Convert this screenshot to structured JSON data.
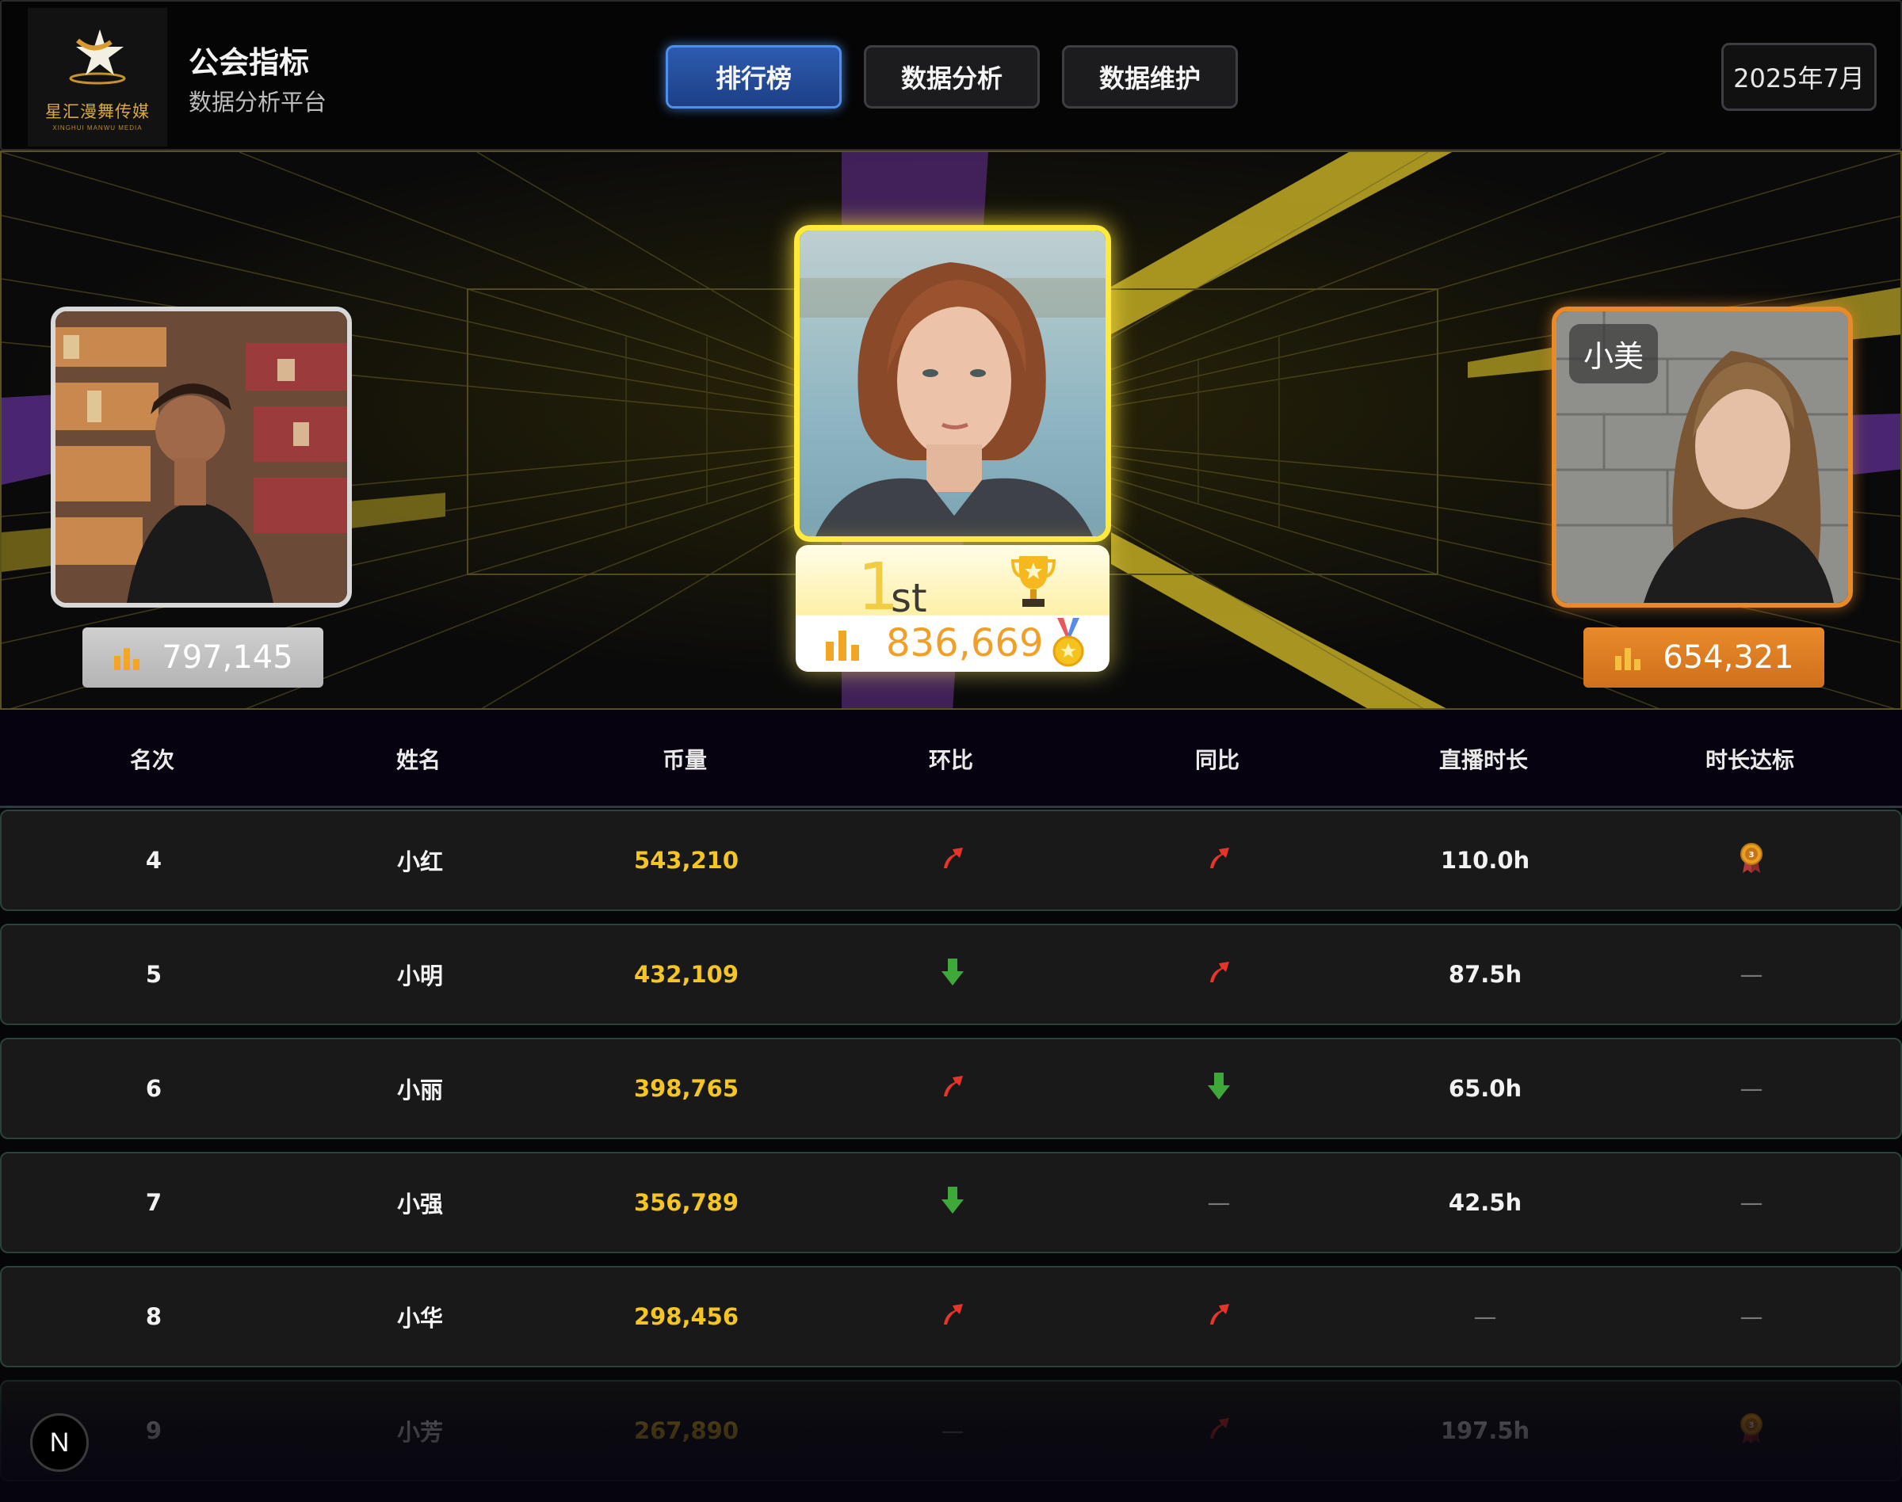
{
  "header": {
    "logo_text": "星汇漫舞传媒",
    "logo_subtext": "XINGHUI MANWU MEDIA",
    "title": "公会指标",
    "subtitle": "数据分析平台",
    "nav": [
      {
        "label": "排行榜",
        "active": true
      },
      {
        "label": "数据分析",
        "active": false
      },
      {
        "label": "数据维护",
        "active": false
      }
    ],
    "month": "2025年7月"
  },
  "podium": {
    "first": {
      "rank_number": "1",
      "rank_suffix": "st",
      "score": "836,669",
      "frame_color": "#ffe93a"
    },
    "second": {
      "score": "797,145",
      "frame_color": "#d8d8d8"
    },
    "third": {
      "name": "小美",
      "score": "654,321",
      "frame_color": "#e88a2a"
    }
  },
  "table": {
    "headers": [
      "名次",
      "姓名",
      "币量",
      "环比",
      "同比",
      "直播时长",
      "时长达标"
    ],
    "rows": [
      {
        "rank": "4",
        "name": "小红",
        "coins": "543,210",
        "mom": "up",
        "yoy": "up",
        "hours": "110.0h",
        "target": "medal"
      },
      {
        "rank": "5",
        "name": "小明",
        "coins": "432,109",
        "mom": "down",
        "yoy": "up",
        "hours": "87.5h",
        "target": "—"
      },
      {
        "rank": "6",
        "name": "小丽",
        "coins": "398,765",
        "mom": "up",
        "yoy": "down",
        "hours": "65.0h",
        "target": "—"
      },
      {
        "rank": "7",
        "name": "小强",
        "coins": "356,789",
        "mom": "down",
        "yoy": "—",
        "hours": "42.5h",
        "target": "—"
      },
      {
        "rank": "8",
        "name": "小华",
        "coins": "298,456",
        "mom": "up",
        "yoy": "up",
        "hours": "—",
        "target": "—"
      },
      {
        "rank": "9",
        "name": "小芳",
        "coins": "267,890",
        "mom": "—",
        "yoy": "up",
        "hours": "197.5h",
        "target": "medal"
      }
    ]
  },
  "dev_badge": "N"
}
